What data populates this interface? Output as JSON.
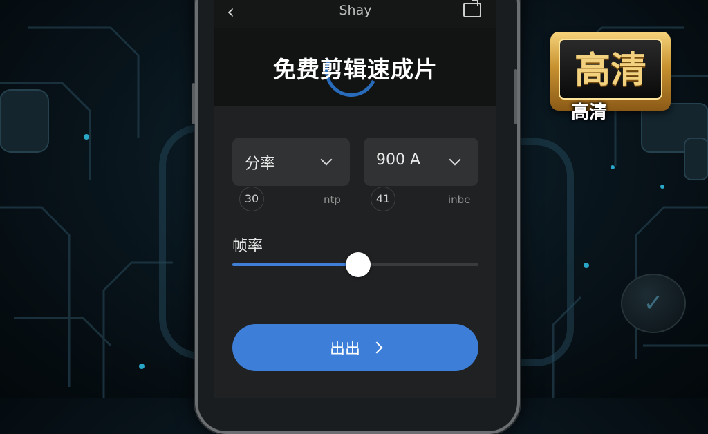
{
  "header": {
    "title": "Shay"
  },
  "hero": {
    "title": "免费剪辑速成片"
  },
  "settings": {
    "resolution": {
      "value": "分率",
      "below_value": "30",
      "unit": "ntp"
    },
    "bitrate": {
      "value": "900 A",
      "below_value": "41",
      "unit": "inbe"
    },
    "frame_rate": {
      "label": "帧率",
      "level_percent": 51
    }
  },
  "export_button": {
    "label": "出出"
  },
  "badge": {
    "big_text": "高清",
    "small_text": "高清"
  },
  "colors": {
    "accent": "#3d7fd8",
    "screen_bg": "#202122",
    "badge_gold": "#c7912f"
  },
  "icons": {
    "back": "chevron-left-icon",
    "share": "share-icon",
    "dropdown": "chevron-down-icon",
    "next": "chevron-right-icon"
  }
}
